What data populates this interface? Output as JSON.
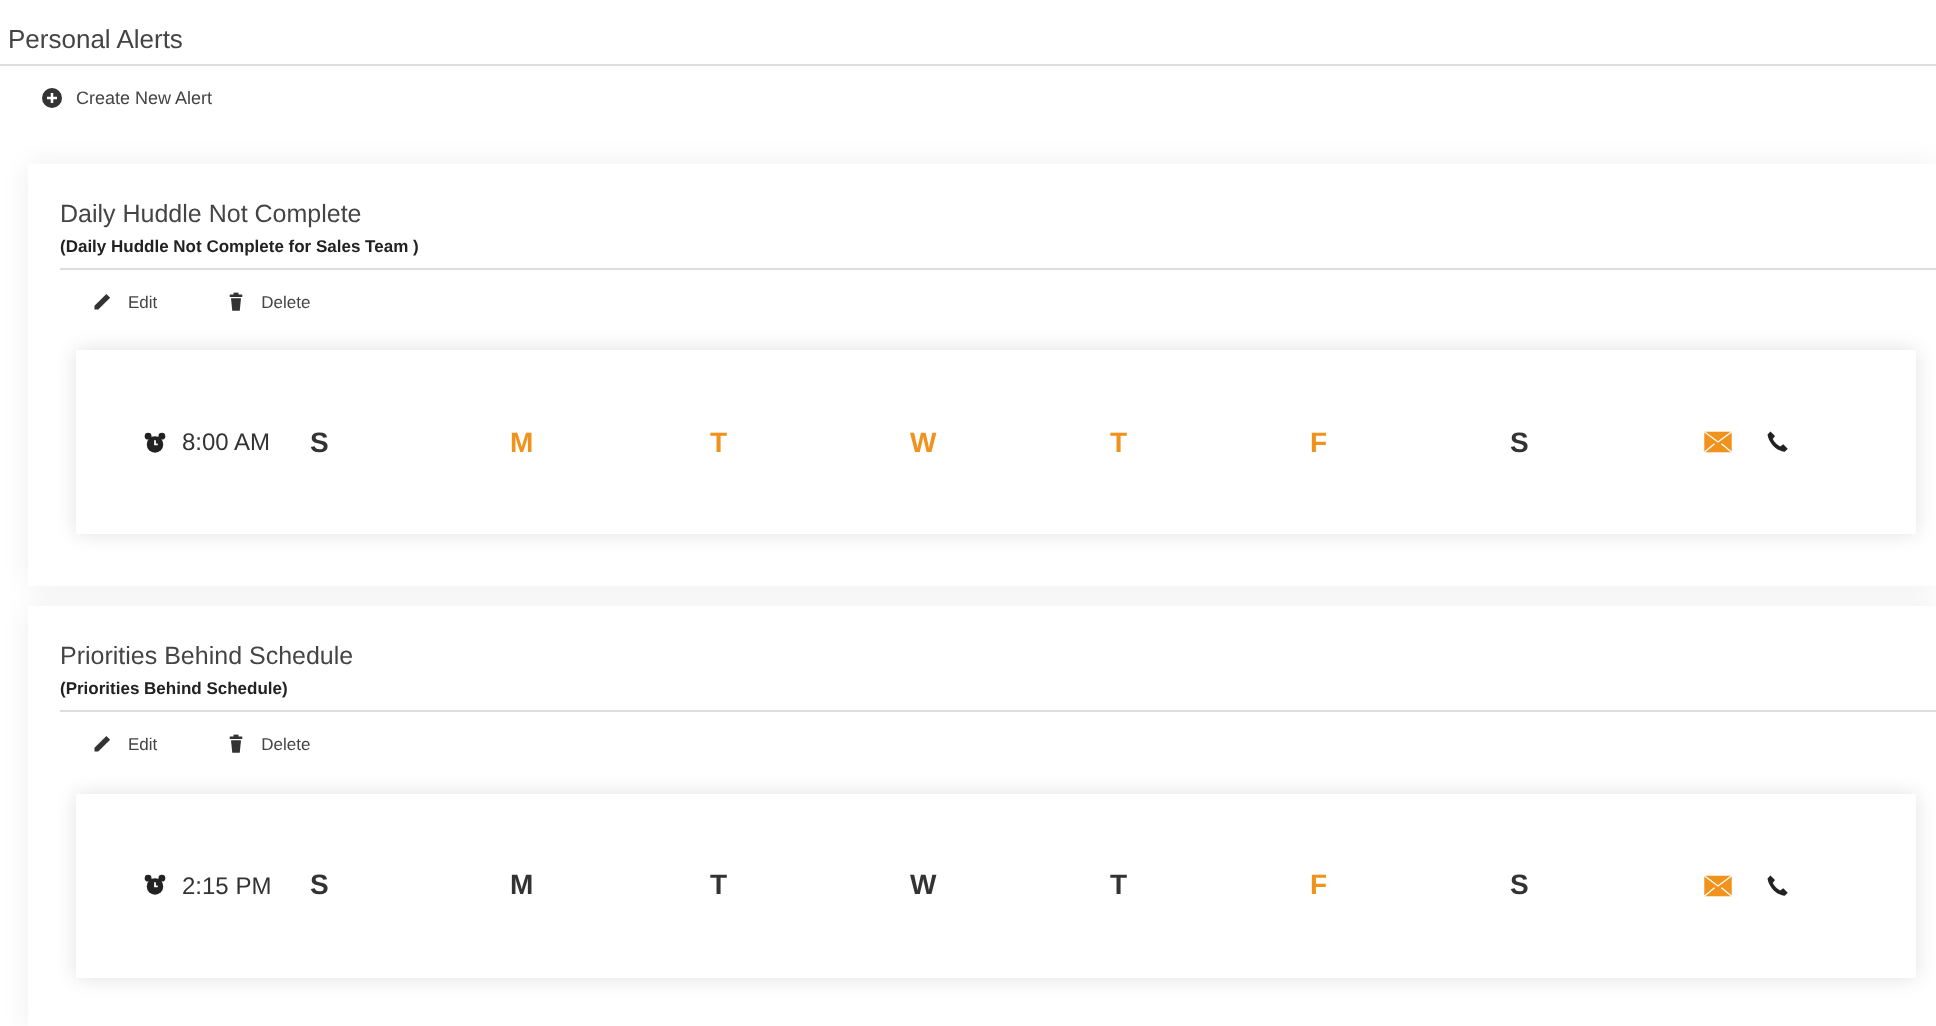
{
  "page": {
    "title": "Personal Alerts",
    "create_link": "Create New Alert"
  },
  "alerts": [
    {
      "title": "Daily Huddle Not Complete",
      "subtitle": "(Daily Huddle Not Complete for Sales Team )",
      "actions": [
        "Edit",
        "Delete"
      ],
      "time": "8:00 AM",
      "days": [
        {
          "label": "S",
          "selected": false
        },
        {
          "label": "M",
          "selected": true
        },
        {
          "label": "T",
          "selected": true
        },
        {
          "label": "W",
          "selected": true
        },
        {
          "label": "T",
          "selected": true
        },
        {
          "label": "F",
          "selected": true
        },
        {
          "label": "S",
          "selected": false
        }
      ],
      "channels": [
        {
          "kind": "email",
          "selected": true
        },
        {
          "kind": "phone",
          "selected": false
        }
      ]
    },
    {
      "title": "Priorities Behind Schedule",
      "subtitle": "(Priorities Behind Schedule)",
      "actions": [
        "Edit",
        "Delete"
      ],
      "time": "2:15 PM",
      "days": [
        {
          "label": "S",
          "selected": false
        },
        {
          "label": "M",
          "selected": false
        },
        {
          "label": "T",
          "selected": false
        },
        {
          "label": "W",
          "selected": false
        },
        {
          "label": "T",
          "selected": false
        },
        {
          "label": "F",
          "selected": true
        },
        {
          "label": "S",
          "selected": false
        }
      ],
      "channels": [
        {
          "kind": "email",
          "selected": true
        },
        {
          "kind": "phone",
          "selected": false
        }
      ]
    }
  ]
}
